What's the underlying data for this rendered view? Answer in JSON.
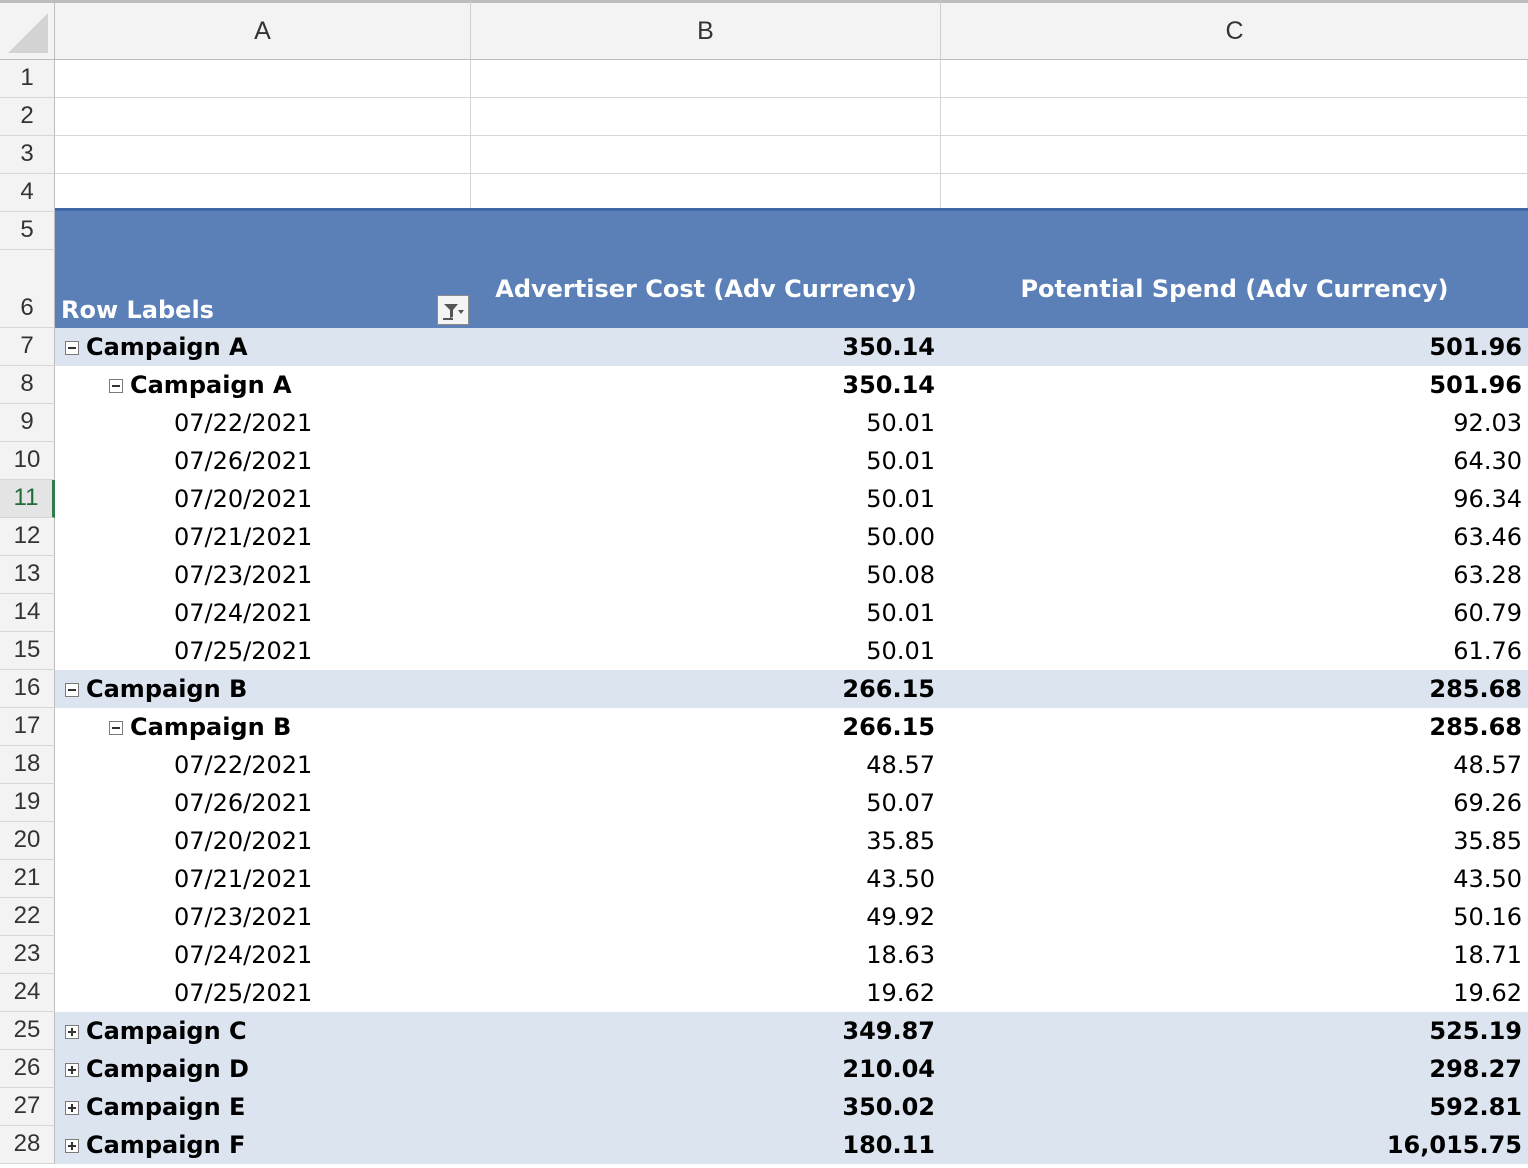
{
  "columns": [
    "A",
    "B",
    "C"
  ],
  "row_numbers": [
    "1",
    "2",
    "3",
    "4",
    "5",
    "6",
    "7",
    "8",
    "9",
    "10",
    "11",
    "12",
    "13",
    "14",
    "15",
    "16",
    "17",
    "18",
    "19",
    "20",
    "21",
    "22",
    "23",
    "24",
    "25",
    "26",
    "27",
    "28"
  ],
  "selected_row": "11",
  "pivot": {
    "row_labels_header": "Row Labels",
    "col_b_header": "Advertiser Cost (Adv Currency)",
    "col_c_header": "Potential Spend (Adv Currency)"
  },
  "rows": [
    {
      "label": "Campaign A",
      "b": "350.14",
      "c": "501.96",
      "level": 0,
      "toggle": "minus"
    },
    {
      "label": "Campaign A",
      "b": "350.14",
      "c": "501.96",
      "level": 1,
      "toggle": "minus"
    },
    {
      "label": "07/22/2021",
      "b": "50.01",
      "c": "92.03",
      "level": 2
    },
    {
      "label": "07/26/2021",
      "b": "50.01",
      "c": "64.30",
      "level": 2
    },
    {
      "label": "07/20/2021",
      "b": "50.01",
      "c": "96.34",
      "level": 2
    },
    {
      "label": "07/21/2021",
      "b": "50.00",
      "c": "63.46",
      "level": 2
    },
    {
      "label": "07/23/2021",
      "b": "50.08",
      "c": "63.28",
      "level": 2
    },
    {
      "label": "07/24/2021",
      "b": "50.01",
      "c": "60.79",
      "level": 2
    },
    {
      "label": "07/25/2021",
      "b": "50.01",
      "c": "61.76",
      "level": 2
    },
    {
      "label": "Campaign B",
      "b": "266.15",
      "c": "285.68",
      "level": 0,
      "toggle": "minus"
    },
    {
      "label": "Campaign B",
      "b": "266.15",
      "c": "285.68",
      "level": 1,
      "toggle": "minus"
    },
    {
      "label": "07/22/2021",
      "b": "48.57",
      "c": "48.57",
      "level": 2
    },
    {
      "label": "07/26/2021",
      "b": "50.07",
      "c": "69.26",
      "level": 2
    },
    {
      "label": "07/20/2021",
      "b": "35.85",
      "c": "35.85",
      "level": 2
    },
    {
      "label": "07/21/2021",
      "b": "43.50",
      "c": "43.50",
      "level": 2
    },
    {
      "label": "07/23/2021",
      "b": "49.92",
      "c": "50.16",
      "level": 2
    },
    {
      "label": "07/24/2021",
      "b": "18.63",
      "c": "18.71",
      "level": 2
    },
    {
      "label": "07/25/2021",
      "b": "19.62",
      "c": "19.62",
      "level": 2
    },
    {
      "label": "Campaign C",
      "b": "349.87",
      "c": "525.19",
      "level": 0,
      "toggle": "plus"
    },
    {
      "label": "Campaign  D",
      "b": "210.04",
      "c": "298.27",
      "level": 0,
      "toggle": "plus"
    },
    {
      "label": "Campaign E",
      "b": "350.02",
      "c": "592.81",
      "level": 0,
      "toggle": "plus"
    },
    {
      "label": "Campaign F",
      "b": "180.11",
      "c": "16,015.75",
      "level": 0,
      "toggle": "plus"
    }
  ]
}
